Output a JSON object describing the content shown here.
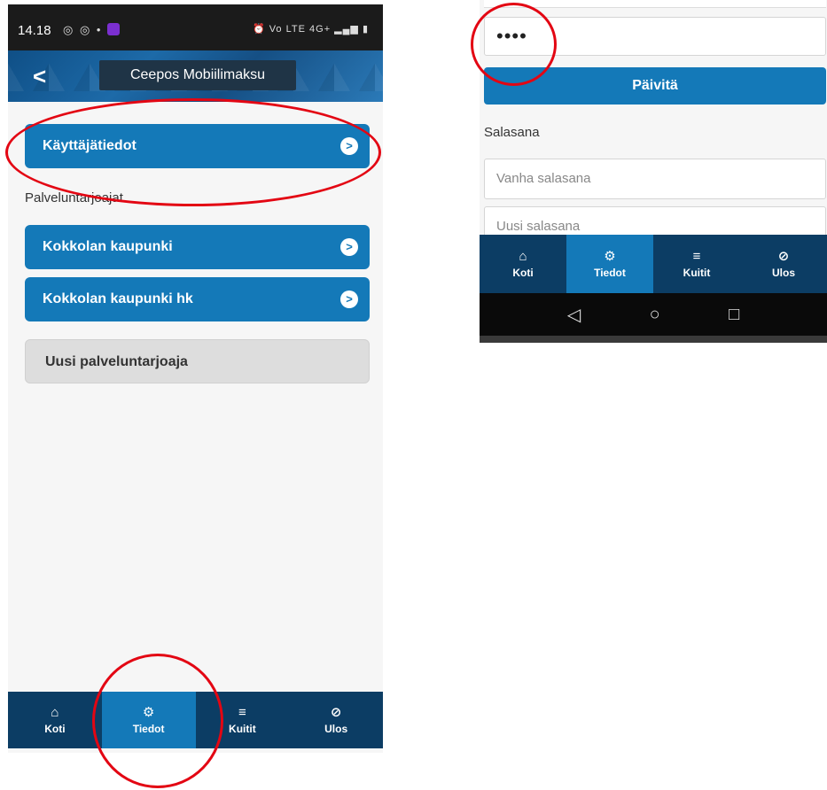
{
  "left": {
    "status": {
      "time": "14.18",
      "notif": "◎ ◎ •",
      "right": "⏰ Vo LTE 4G+ ▂▄▆ ▮"
    },
    "header": {
      "title": "Ceepos Mobiilimaksu"
    },
    "user_info_label": "Käyttäjätiedot",
    "section_label": "Palveluntarjoajat",
    "providers": [
      "Kokkolan kaupunki",
      "Kokkolan kaupunki hk"
    ],
    "new_provider_label": "Uusi palveluntarjoaja"
  },
  "tabs": [
    {
      "label": "Koti",
      "icon": "home-icon",
      "glyph": "⌂"
    },
    {
      "label": "Tiedot",
      "icon": "gear-icon",
      "glyph": "⚙"
    },
    {
      "label": "Kuitit",
      "icon": "menu-icon",
      "glyph": "≡"
    },
    {
      "label": "Ulos",
      "icon": "logout-icon",
      "glyph": "⊘"
    }
  ],
  "right": {
    "password_value": "••••",
    "update_label": "Päivitä",
    "password_section": "Salasana",
    "old_password_placeholder": "Vanha salasana",
    "new_password_placeholder": "Uusi salasana",
    "android_nav": [
      "◁",
      "○",
      "□"
    ]
  },
  "colors": {
    "primary": "#1479b8",
    "tab_bar": "#0c3d64",
    "annotation": "#e30613"
  }
}
